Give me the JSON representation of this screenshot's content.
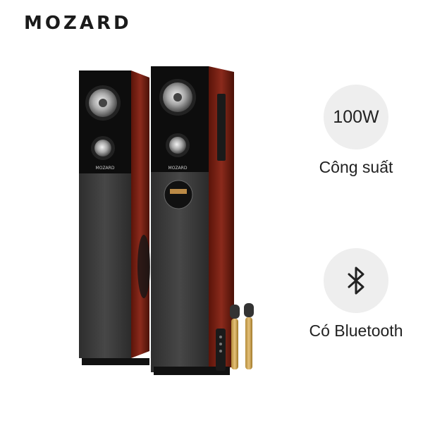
{
  "brand": {
    "name": "MOZARD"
  },
  "product": {
    "speaker_logo": "MOZARD"
  },
  "features": [
    {
      "value": "100W",
      "label": "Công suất",
      "icon": "power-value"
    },
    {
      "value": "",
      "label": "Có Bluetooth",
      "icon": "bluetooth-icon"
    }
  ],
  "colors": {
    "wood": "#8b2a1c",
    "speaker_front": "#3a3a3a",
    "gloss_black": "#0d0d0d",
    "feature_circle": "#eeeeee",
    "text": "#222222"
  }
}
